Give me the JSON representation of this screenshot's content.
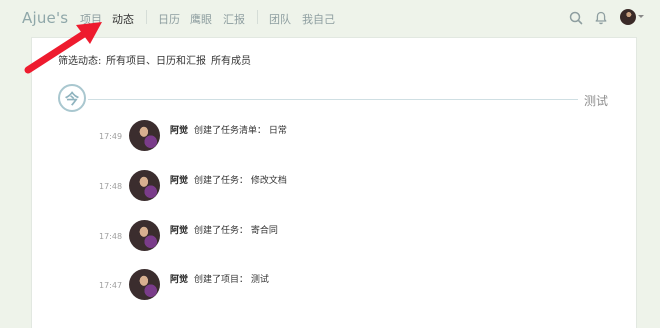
{
  "nav": {
    "brand": "Ajue's",
    "items": [
      "项目",
      "动态",
      "日历",
      "鹰眼",
      "汇报",
      "团队",
      "我自己"
    ]
  },
  "filter": {
    "label": "筛选动态:",
    "scope": "所有项目、日历和汇报",
    "members": "所有成员"
  },
  "timeline": {
    "today_badge": "今",
    "title": "测试"
  },
  "activities": [
    {
      "time": "17:49",
      "actor": "阿觉",
      "action": "创建了任务清单： 日常"
    },
    {
      "time": "17:48",
      "actor": "阿觉",
      "action": "创建了任务： 修改文档"
    },
    {
      "time": "17:48",
      "actor": "阿觉",
      "action": "创建了任务： 寄合同"
    },
    {
      "time": "17:47",
      "actor": "阿觉",
      "action": "创建了项目： 测试"
    }
  ],
  "colors": {
    "background": "#eef3ea",
    "annotation_arrow": "#ee1b2e",
    "timeline_accent": "#a9c7cf"
  }
}
